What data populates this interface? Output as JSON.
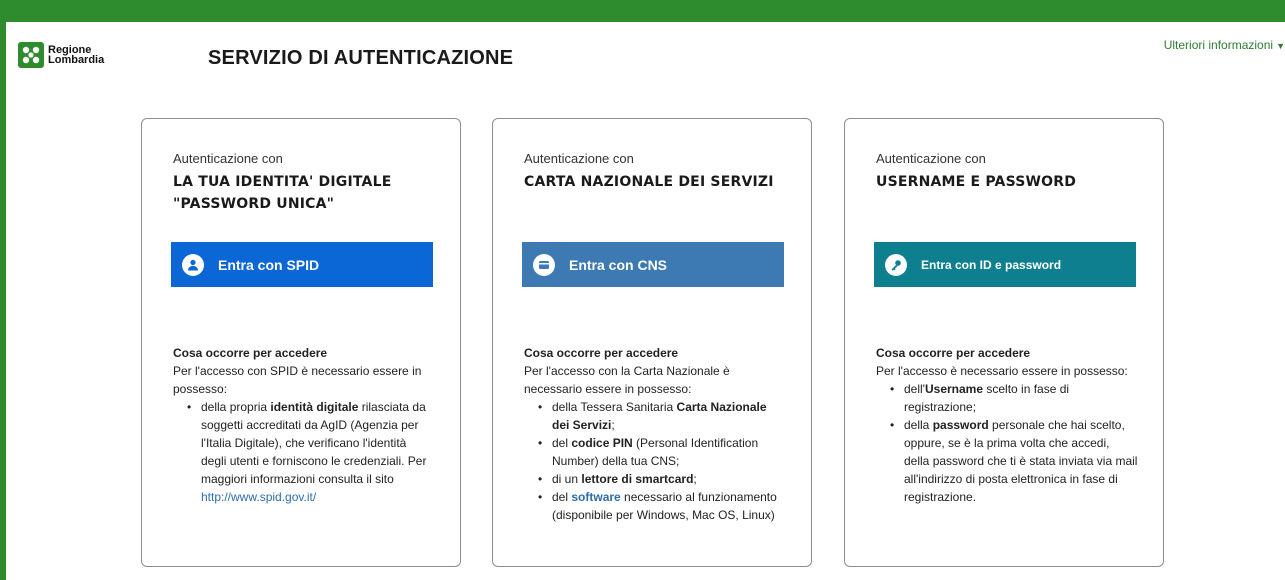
{
  "header": {
    "logo_line1": "Regione",
    "logo_line2": "Lombardia",
    "title": "SERVIZIO DI AUTENTICAZIONE",
    "more_info": "Ulteriori informazioni",
    "brand_color": "#2e8b2e"
  },
  "cards": [
    {
      "intro": "Autenticazione con",
      "heading_line1": "LA TUA IDENTITA' DIGITALE",
      "heading_line2": "\"PASSWORD UNICA\"",
      "button_label": "Entra con SPID",
      "button_icon": "user-icon",
      "button_color": "#0b66d6",
      "req_title": "Cosa occorre per accedere",
      "req_intro": "Per l'accesso con SPID è necessario essere in possesso:",
      "items": [
        {
          "t1": "della propria ",
          "b1": "identità digitale",
          "t2": " rilasciata da soggetti accreditati da AgID (Agenzia per l'Italia Digitale), che verificano l'identità degli utenti e forniscono le credenziali. Per maggiori informazioni consulta il sito ",
          "link": "http://www.spid.gov.it/"
        }
      ]
    },
    {
      "intro": "Autenticazione con",
      "heading_line1": "CARTA NAZIONALE DEI SERVIZI",
      "button_label": "Entra con CNS",
      "button_icon": "card-icon",
      "button_color": "#3d79b2",
      "req_title": "Cosa occorre per accedere",
      "req_intro": "Per l'accesso con la Carta Nazionale è necessario essere in possesso:",
      "items": [
        {
          "t1": "della Tessera Sanitaria ",
          "b1": "Carta Nazionale dei Servizi",
          "t2": ";"
        },
        {
          "t1": "del ",
          "b1": "codice PIN",
          "t2": " (Personal Identification Number) della tua CNS;"
        },
        {
          "t1": "di un ",
          "b1": "lettore di smartcard",
          "t2": ";"
        },
        {
          "t1": "del ",
          "link": "software",
          "t2": " necessario al funzionamento (disponibile per Windows, Mac OS, Linux)"
        }
      ]
    },
    {
      "intro": "Autenticazione con",
      "heading_line1": "USERNAME E PASSWORD",
      "button_label": "Entra con ID e password",
      "button_icon": "key-icon",
      "button_color": "#0d7f8f",
      "req_title": "Cosa occorre per accedere",
      "req_intro": "Per l'accesso è necessario essere in possesso:",
      "items": [
        {
          "t1": "dell'",
          "b1": "Username",
          "t2": " scelto in fase di registrazione;"
        },
        {
          "t1": "della ",
          "b1": "password",
          "t2": " personale che hai scelto, oppure, se è la prima volta che accedi, della password che ti è stata inviata via mail all'indirizzo di posta elettronica in fase di registrazione."
        }
      ]
    }
  ]
}
